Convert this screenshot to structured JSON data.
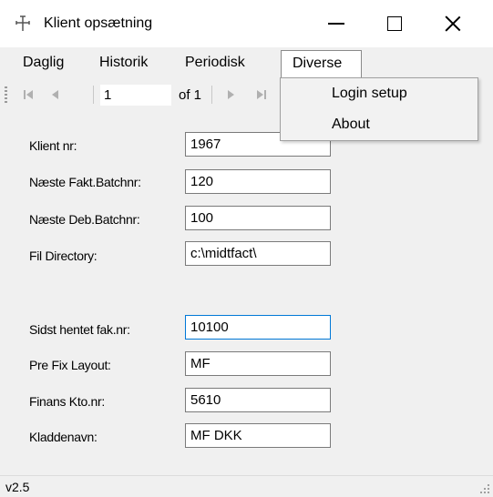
{
  "window": {
    "title": "Klient opsætning",
    "icon": "app-pin-icon",
    "controls": [
      "minimize-icon",
      "maximize-icon",
      "close-icon"
    ]
  },
  "menubar": {
    "items": [
      {
        "label": "Daglig"
      },
      {
        "label": "Historik"
      },
      {
        "label": "Periodisk"
      },
      {
        "label": "Diverse",
        "open": true
      }
    ]
  },
  "navigator": {
    "position": "1",
    "of_label": "of 1",
    "icons": [
      "move-first-icon",
      "move-previous-icon",
      "move-next-icon",
      "move-last-icon"
    ]
  },
  "dropdown": {
    "items": [
      {
        "label": "Login setup"
      },
      {
        "label": "About"
      }
    ]
  },
  "form": {
    "fields": [
      {
        "label": "Klient nr:",
        "value": "1967"
      },
      {
        "label": "Næste Fakt.Batchnr:",
        "value": "120"
      },
      {
        "label": "Næste Deb.Batchnr:",
        "value": "100"
      },
      {
        "label": "Fil Directory:",
        "value": "c:\\midtfact\\"
      },
      {
        "label": "Sidst hentet fak.nr:",
        "value": "10100"
      },
      {
        "label": "Pre Fix Layout:",
        "value": "MF"
      },
      {
        "label": "Finans Kto.nr:",
        "value": "5610"
      },
      {
        "label": "Kladdenavn:",
        "value": "MF DKK"
      }
    ]
  },
  "statusbar": {
    "version": "v2.5"
  },
  "colors": {
    "focus_border": "#0078d7",
    "window_bg": "#f0f0f0"
  }
}
